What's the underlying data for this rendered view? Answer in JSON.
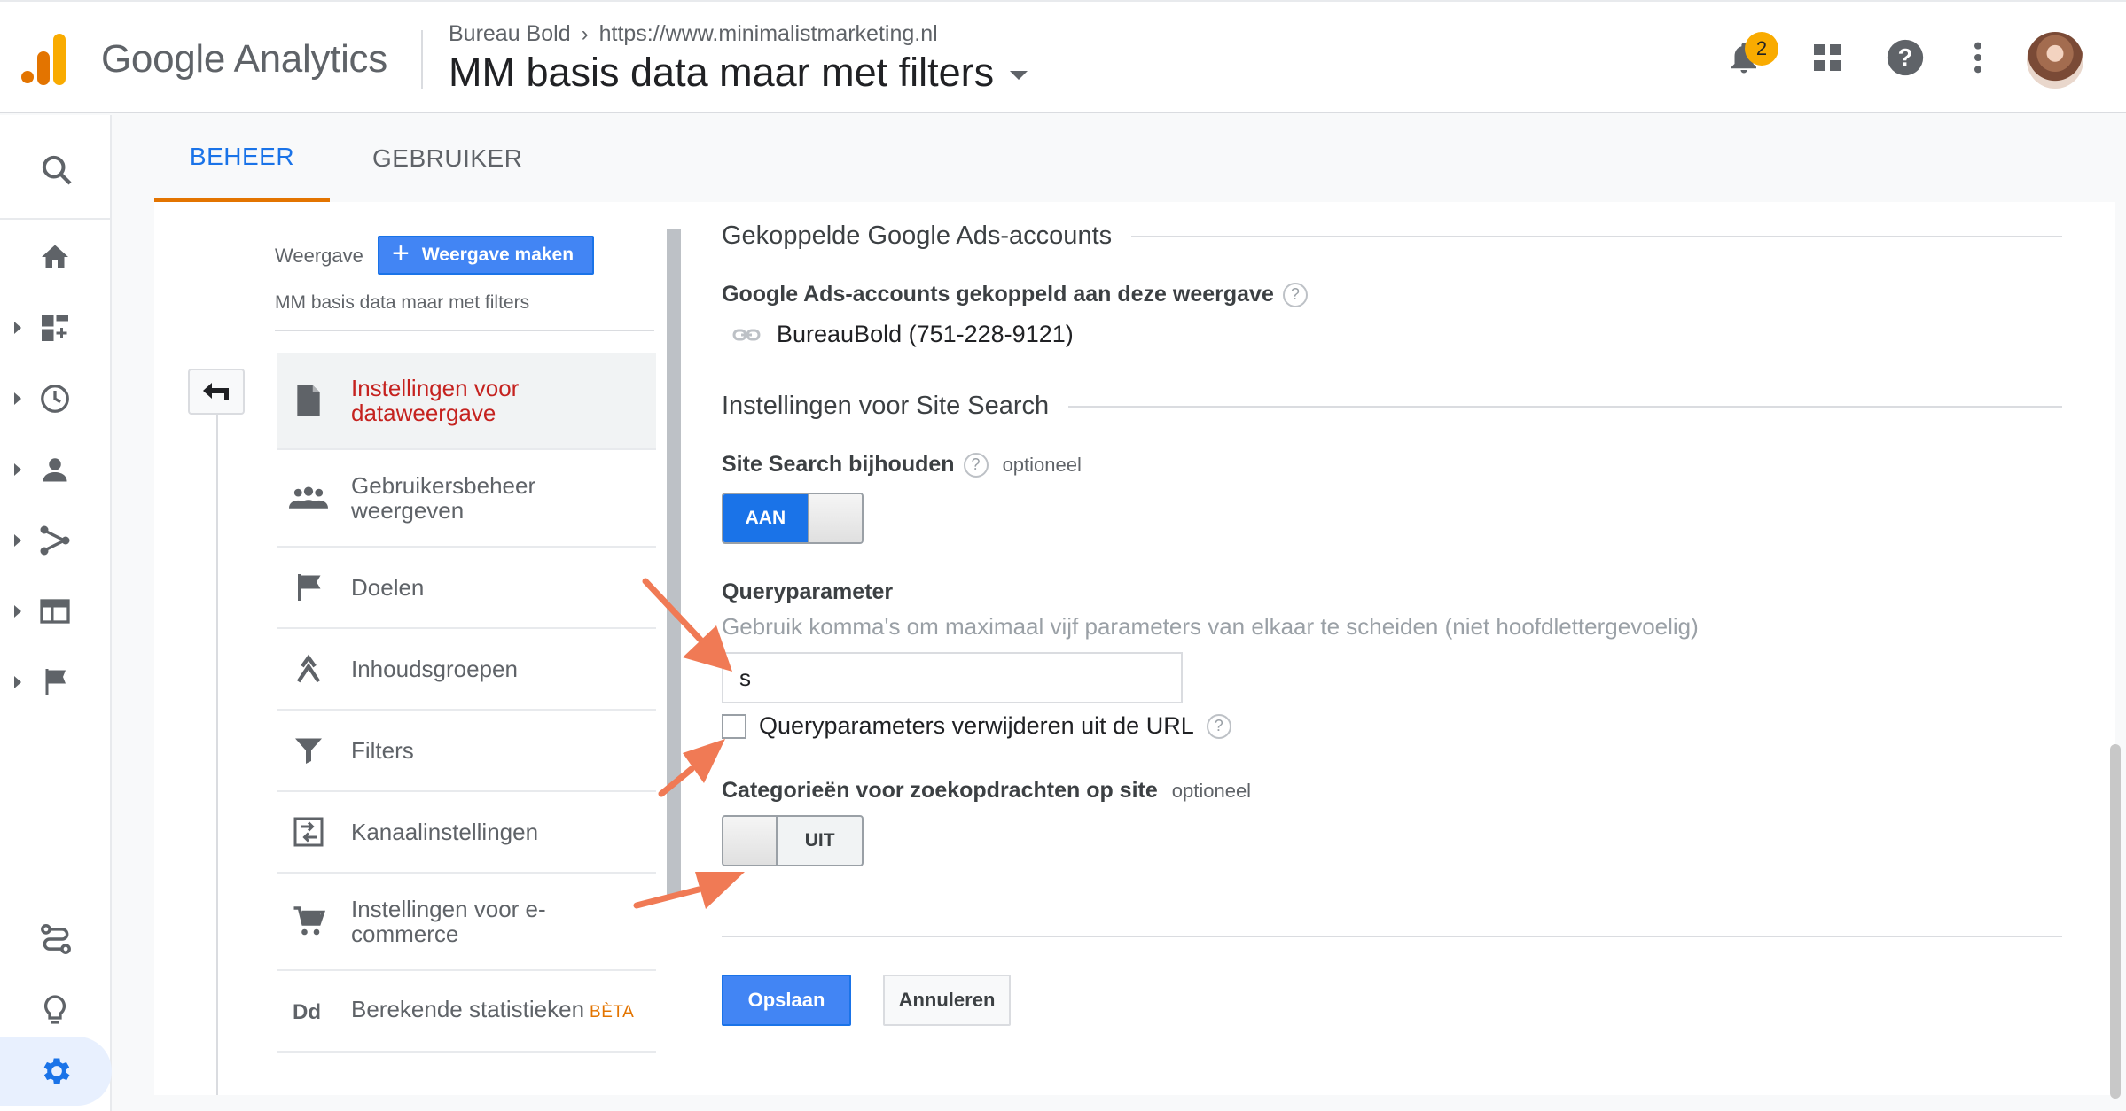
{
  "header": {
    "product_name": "Google Analytics",
    "breadcrumb": {
      "account": "Bureau Bold",
      "property": "https://www.minimalistmarketing.nl"
    },
    "view_name": "MM basis data maar met filters",
    "notifications_count": "2",
    "icons": [
      "bell-icon",
      "apps-grid-icon",
      "help-icon",
      "more-vert-icon",
      "avatar"
    ]
  },
  "left_nav": {
    "items": [
      "search-icon",
      "home-icon",
      "customization-icon",
      "realtime-icon",
      "audience-icon",
      "acquisition-icon",
      "behavior-icon",
      "conversions-icon",
      "attribution-icon",
      "discover-icon",
      "admin-gear-icon"
    ]
  },
  "tabs": [
    {
      "label": "BEHEER",
      "active": true
    },
    {
      "label": "GEBRUIKER",
      "active": false
    }
  ],
  "view_column": {
    "label": "Weergave",
    "create_button": "Weergave maken",
    "selected_view": "MM basis data maar met filters",
    "menu": [
      {
        "label": "Instellingen voor dataweergave",
        "icon": "document-icon",
        "active": true
      },
      {
        "label": "Gebruikersbeheer weergeven",
        "icon": "people-icon",
        "active": false
      },
      {
        "label": "Doelen",
        "icon": "flag-icon",
        "active": false
      },
      {
        "label": "Inhoudsgroepen",
        "icon": "content-grouping-icon",
        "active": false
      },
      {
        "label": "Filters",
        "icon": "filter-icon",
        "active": false
      },
      {
        "label": "Kanaalinstellingen",
        "icon": "channel-settings-icon",
        "active": false
      },
      {
        "label": "Instellingen voor e-commerce",
        "icon": "cart-icon",
        "active": false
      },
      {
        "label": "Berekende statistieken",
        "badge": "BÈTA",
        "icon": "dd-icon",
        "active": false
      }
    ]
  },
  "form": {
    "ads_section_title": "Gekoppelde Google Ads-accounts",
    "ads_label": "Google Ads-accounts gekoppeld aan deze weergave",
    "ads_account": "BureauBold (751-228-9121)",
    "site_search_section_title": "Instellingen voor Site Search",
    "site_search_label": "Site Search bijhouden",
    "optional": "optioneel",
    "site_search_toggle": "AAN",
    "query_param_label": "Queryparameter",
    "query_param_hint": "Gebruik komma's om maximaal vijf parameters van elkaar te scheiden (niet hoofdlettergevoelig)",
    "query_param_value": "s",
    "remove_params_label": "Queryparameters verwijderen uit de URL",
    "categories_label": "Categorieën voor zoekopdrachten op site",
    "categories_toggle": "UIT",
    "save_button": "Opslaan",
    "cancel_button": "Annuleren",
    "help_glyph": "?"
  },
  "colors": {
    "accent_blue": "#1a73e8",
    "analytics_orange": "#e37400",
    "analytics_yellow": "#f9ab00",
    "active_menu_red": "#c5221f",
    "annotation_arrow": "#f07a55"
  }
}
